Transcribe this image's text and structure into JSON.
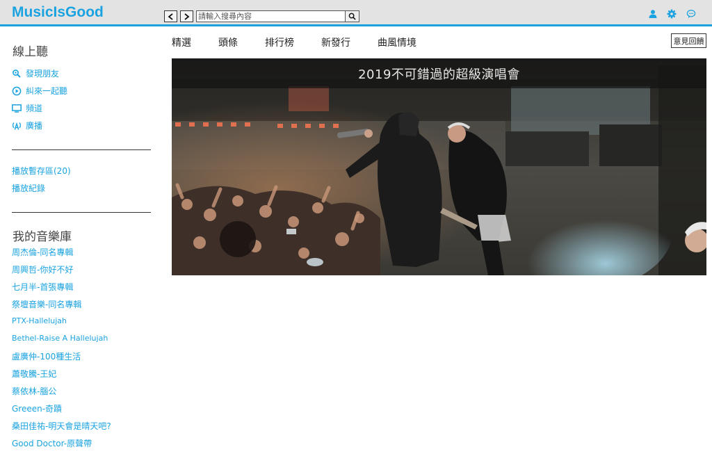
{
  "app": {
    "logo": "MusicIsGood",
    "accent": "#1aa3e0"
  },
  "search": {
    "placeholder": "請輸入搜尋內容"
  },
  "header_icons": [
    "user-icon",
    "gear-icon",
    "chat-icon"
  ],
  "sidebar": {
    "online_heading": "線上聽",
    "online_items": [
      {
        "label": "發現朋友",
        "icon": "search-user-icon"
      },
      {
        "label": "糾來一起聽",
        "icon": "play-circle-icon"
      },
      {
        "label": "頻道",
        "icon": "monitor-icon"
      },
      {
        "label": "廣播",
        "icon": "broadcast-icon"
      }
    ],
    "queue_label": "播放暫存區(20)",
    "history_label": "播放紀錄",
    "library_heading": "我的音樂庫",
    "library_items": [
      "周杰倫-同名專輯",
      "周興哲-你好不好",
      "七月半-首張專輯",
      "祭壇音樂-同名專輯",
      "PTX-Hallelujah",
      "Bethel-Raise A Hallelujah",
      "盧廣仲-100種生活",
      "蕭敬騰-王妃",
      "蔡依林-腦公",
      "Greeen-奇蹟",
      "桑田佳祐-明天會是晴天吧?",
      "Good Doctor-原聲帶"
    ]
  },
  "tabs": [
    {
      "label": "精選"
    },
    {
      "label": "頭條"
    },
    {
      "label": "排行榜"
    },
    {
      "label": "新發行"
    },
    {
      "label": "曲風情境"
    }
  ],
  "feedback_label": "意見回饋",
  "banner": {
    "title": "2019不可錯過的超級演唱會"
  }
}
